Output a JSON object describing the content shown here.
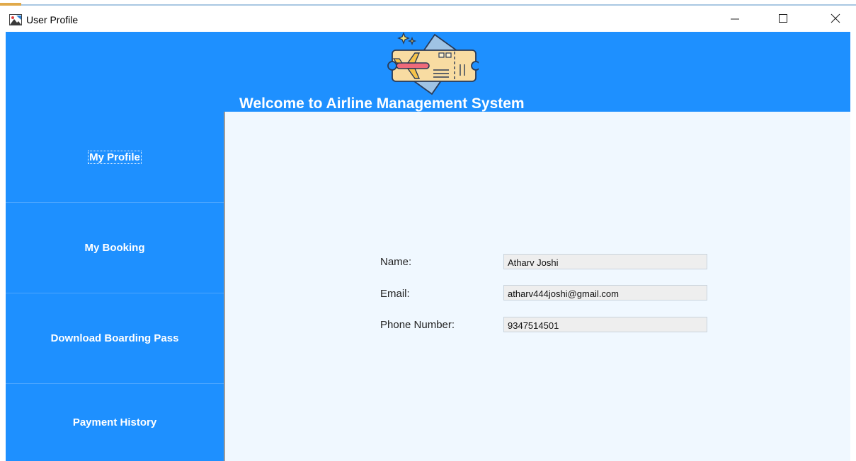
{
  "window": {
    "title": "User Profile",
    "controls": {
      "minimize_icon": "minimize-icon",
      "maximize_icon": "maximize-icon",
      "close_icon": "close-icon"
    }
  },
  "header": {
    "welcome_text": "Welcome to Airline Management System",
    "logo_icon": "boarding-pass-plane-icon",
    "background_color": "#1e90ff"
  },
  "sidebar": {
    "items": [
      {
        "label": "My Profile",
        "active": true
      },
      {
        "label": "My Booking"
      },
      {
        "label": "Download Boarding Pass"
      },
      {
        "label": "Payment History"
      }
    ]
  },
  "profile": {
    "fields": [
      {
        "label": "Name:",
        "value": "Atharv Joshi"
      },
      {
        "label": "Email:",
        "value": "atharv444joshi@gmail.com"
      },
      {
        "label": "Phone Number:",
        "value": "9347514501"
      }
    ]
  },
  "colors": {
    "primary": "#1e90ff",
    "content_bg": "#f0f8ff"
  }
}
